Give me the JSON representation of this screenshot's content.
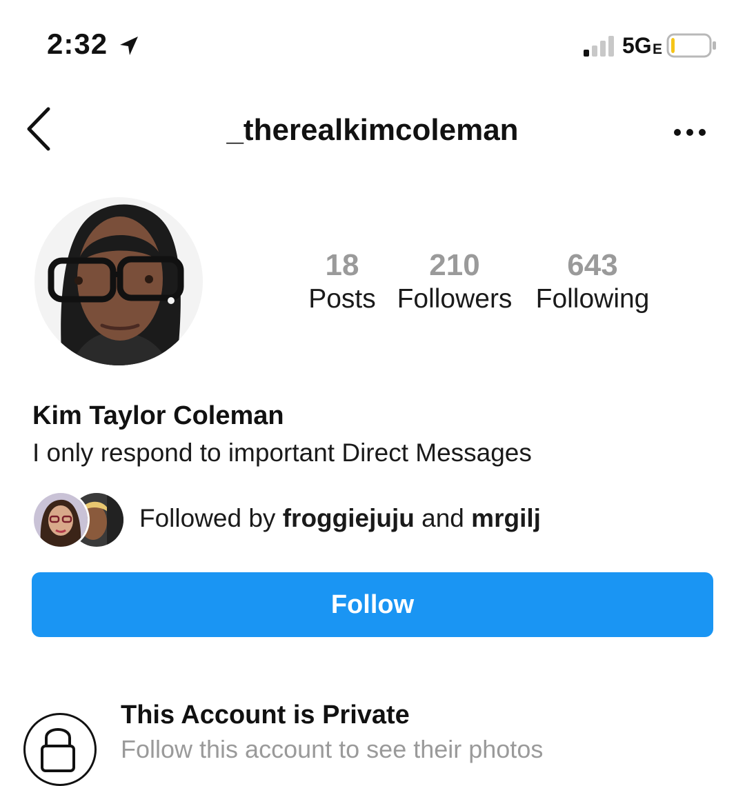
{
  "status_bar": {
    "time": "2:32",
    "network": "5G",
    "network_suffix": "E",
    "location_icon": "location-arrow-icon",
    "signal_icon": "cell-signal-icon",
    "battery_icon": "battery-low-icon",
    "battery_level": 0.1
  },
  "header": {
    "username": "_therealkimcoleman",
    "back_icon": "chevron-left-icon",
    "more_icon": "more-horizontal-icon"
  },
  "stats": [
    {
      "value": "18",
      "label": "Posts"
    },
    {
      "value": "210",
      "label": "Followers"
    },
    {
      "value": "643",
      "label": "Following"
    }
  ],
  "profile": {
    "display_name": "Kim Taylor Coleman",
    "bio": "I only respond to important Direct Messages"
  },
  "followed_by": {
    "prefix": "Followed by",
    "user1": "froggiejuju",
    "conj": "and",
    "user2": "mrgilj"
  },
  "follow_button": {
    "label": "Follow"
  },
  "private": {
    "title": "This Account is Private",
    "subtitle": "Follow this account to see their photos",
    "icon": "lock-icon"
  },
  "colors": {
    "accent": "#1a95f3",
    "stat_number": "#9a9a9a",
    "text": "#111111",
    "battery_fill": "#f5c518"
  }
}
